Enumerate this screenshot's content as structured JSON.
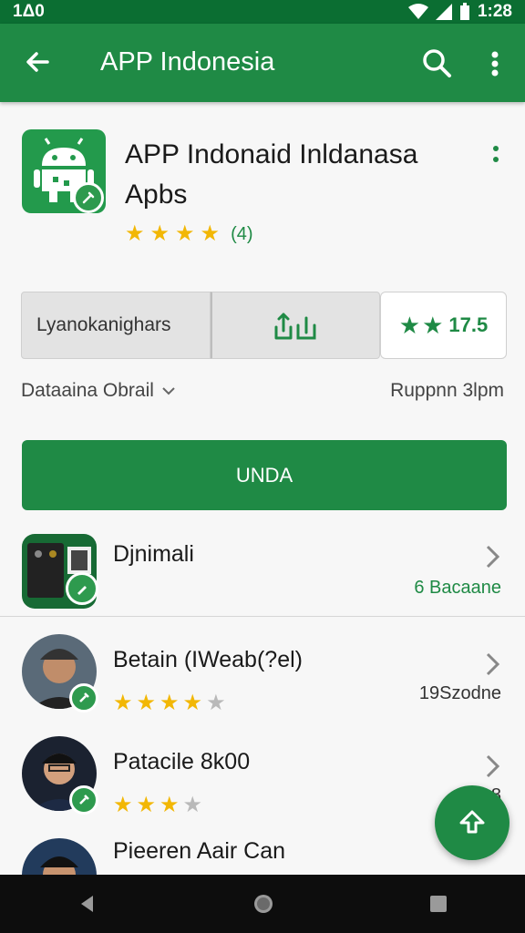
{
  "status": {
    "time": "1:28",
    "left": "1Δ0"
  },
  "appbar": {
    "title": "APP Indonesia"
  },
  "app": {
    "title_line1": "APP Indonaid Inldanasa",
    "title_line2": "Apbs",
    "rating_stars": 4,
    "rating_count": "(4)"
  },
  "actions": {
    "left_label": "Lyanokanighars",
    "right_value": "17.5"
  },
  "details": {
    "left_label": "Dataaina Obrail",
    "right_label": "Ruppnn 3lpm"
  },
  "primary_button": {
    "label": "UNDA"
  },
  "list": [
    {
      "name": "Djnimali",
      "meta": "6 Bacaane",
      "stars": null
    },
    {
      "name": "Betain (IWeab(?el)",
      "meta": "19Szodne",
      "stars": 4
    },
    {
      "name": "Patacile 8k00",
      "meta": "2 8",
      "stars": 3.5
    },
    {
      "name": "Pieeren Aair Can",
      "meta": "",
      "stars": null
    }
  ],
  "colors": {
    "primary": "#1f8a45",
    "dark": "#0b6e32",
    "star": "#f2b705"
  }
}
